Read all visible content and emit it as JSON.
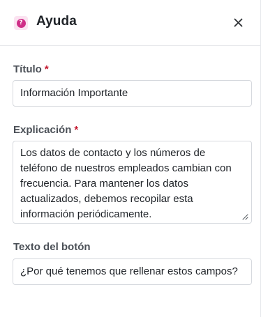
{
  "header": {
    "title": "Ayuda",
    "help_icon_glyph": "?",
    "icon_name": "help-icon",
    "close_icon_name": "close-icon",
    "accent_color": "#cf2e87"
  },
  "form": {
    "title_field": {
      "label": "Título",
      "required_mark": "*",
      "value": "Información Importante"
    },
    "explanation_field": {
      "label": "Explicación",
      "required_mark": "*",
      "value": "Los datos de contacto y los números de teléfono de nuestros empleados cambian con frecuencia. Para mantener los datos actualizados, debemos recopilar esta información periódicamente."
    },
    "button_text_field": {
      "label": "Texto del botón",
      "value": "¿Por qué tenemos que rellenar estos campos?"
    }
  },
  "colors": {
    "required": "#c4182f",
    "border": "#d6d9de"
  }
}
